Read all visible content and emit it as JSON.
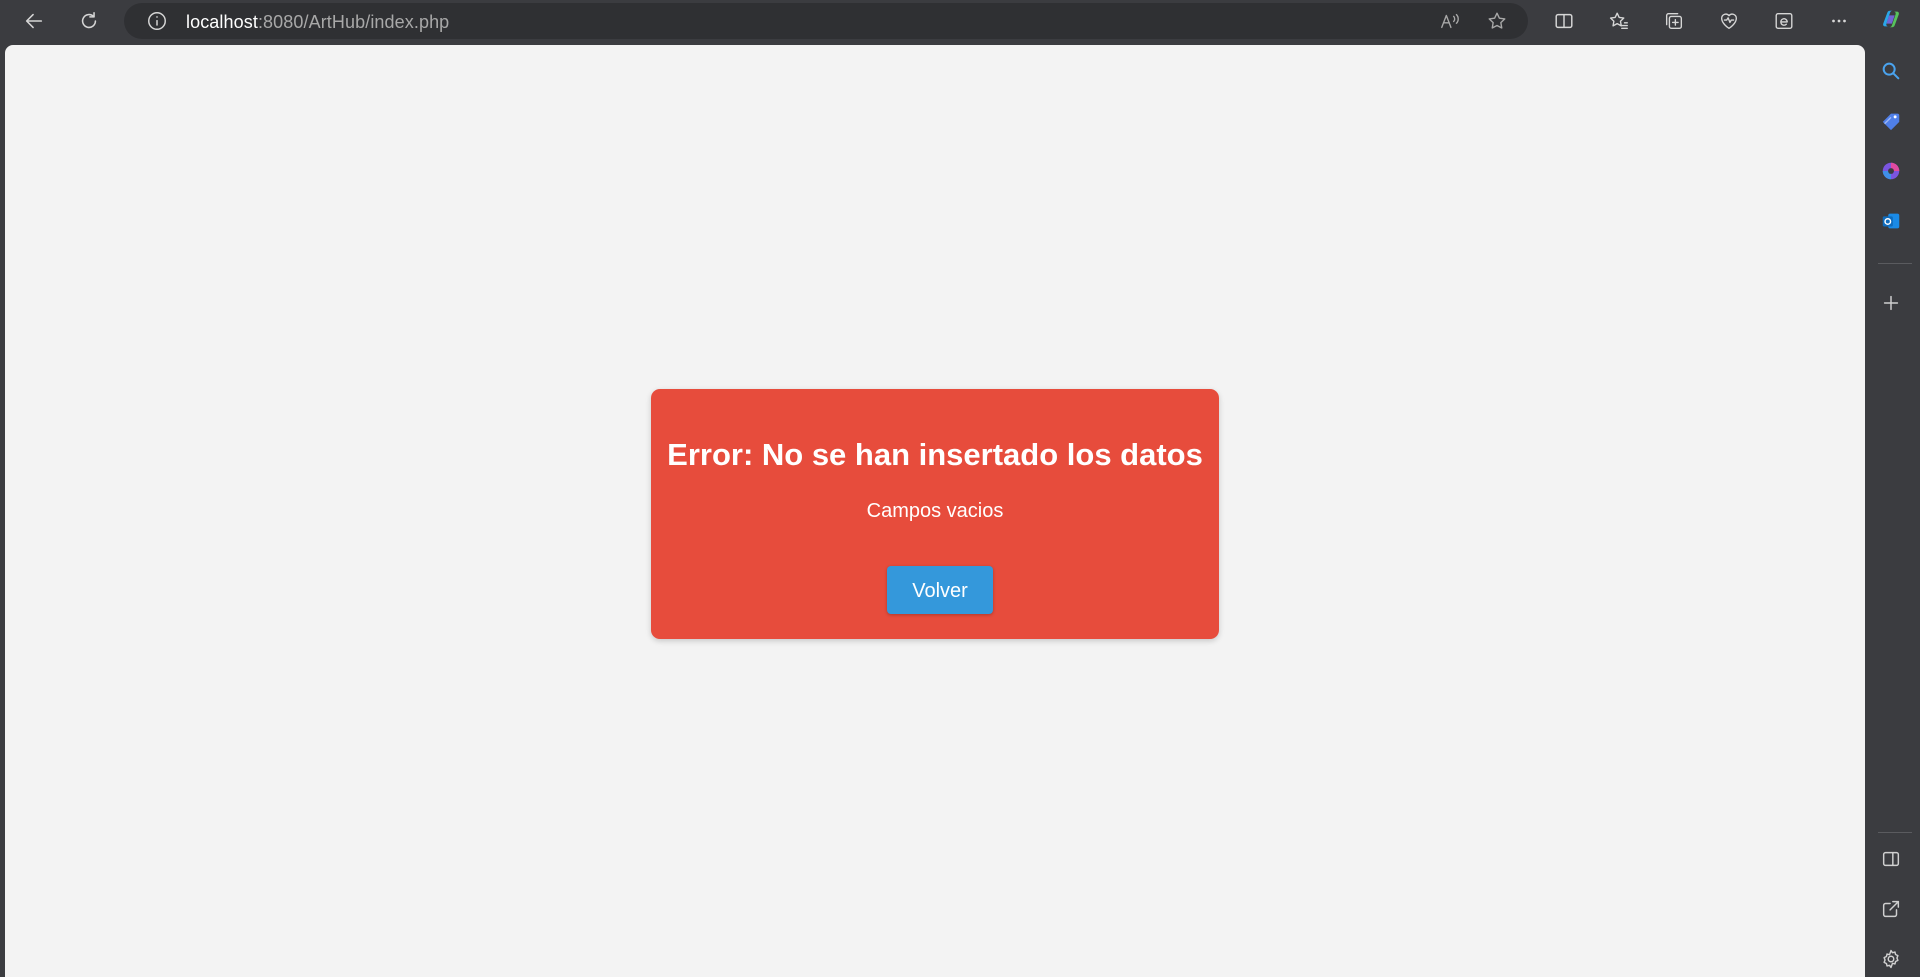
{
  "browser": {
    "url_host": "localhost",
    "url_rest": ":8080/ArtHub/index.php",
    "nav_icons": [
      "back-icon",
      "refresh-icon"
    ],
    "address_icons": [
      "site-info-icon",
      "read-aloud-icon",
      "favorite-star-icon"
    ],
    "toolbar_icons": [
      "split-screen-icon",
      "favorites-icon",
      "collections-icon",
      "browser-essentials-icon",
      "internet-explorer-mode-icon",
      "more-options-icon",
      "copilot-icon"
    ]
  },
  "sidebar": {
    "icons": [
      "search-icon",
      "shopping-tag-icon",
      "office-icon",
      "outlook-icon",
      "add-icon",
      "sidebar-toggle-icon",
      "external-link-icon",
      "settings-icon"
    ]
  },
  "error_card": {
    "title": "Error: No se han insertado los datos",
    "message": "Campos vacios",
    "button_label": "Volver",
    "background_color": "#e74c3c",
    "button_color": "#3498db"
  }
}
